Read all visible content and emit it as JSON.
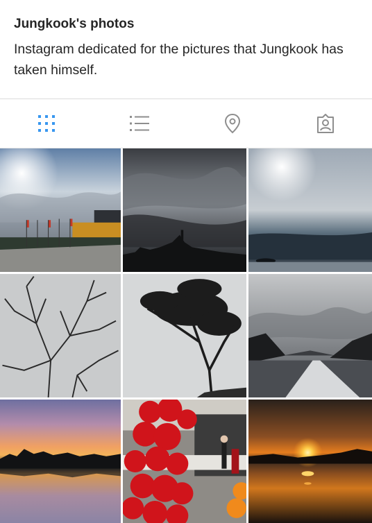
{
  "profile": {
    "name": "Jungkook's photos",
    "bio": "Instagram dedicated for the pictures that Jungkook has taken himself."
  },
  "tabs": [
    {
      "icon": "grid-icon",
      "active": true
    },
    {
      "icon": "list-icon",
      "active": false
    },
    {
      "icon": "location-pin-icon",
      "active": false
    },
    {
      "icon": "tagged-person-icon",
      "active": false
    }
  ],
  "colors": {
    "active_tab": "#3897f0",
    "inactive_tab": "#8e8e8e",
    "text": "#262626",
    "divider": "#dbdbdb"
  },
  "photos": [
    {
      "subject": "street with flags under bright sun"
    },
    {
      "subject": "dark cloudy sky over city silhouette"
    },
    {
      "subject": "sun over calm sea with island"
    },
    {
      "subject": "bare tree branches against grey sky"
    },
    {
      "subject": "tree silhouette on hill"
    },
    {
      "subject": "boat wake between mountains"
    },
    {
      "subject": "orange sunset over lake with tree line"
    },
    {
      "subject": "red heart balloons in front of building"
    },
    {
      "subject": "sunset over water with orange reflection"
    }
  ]
}
